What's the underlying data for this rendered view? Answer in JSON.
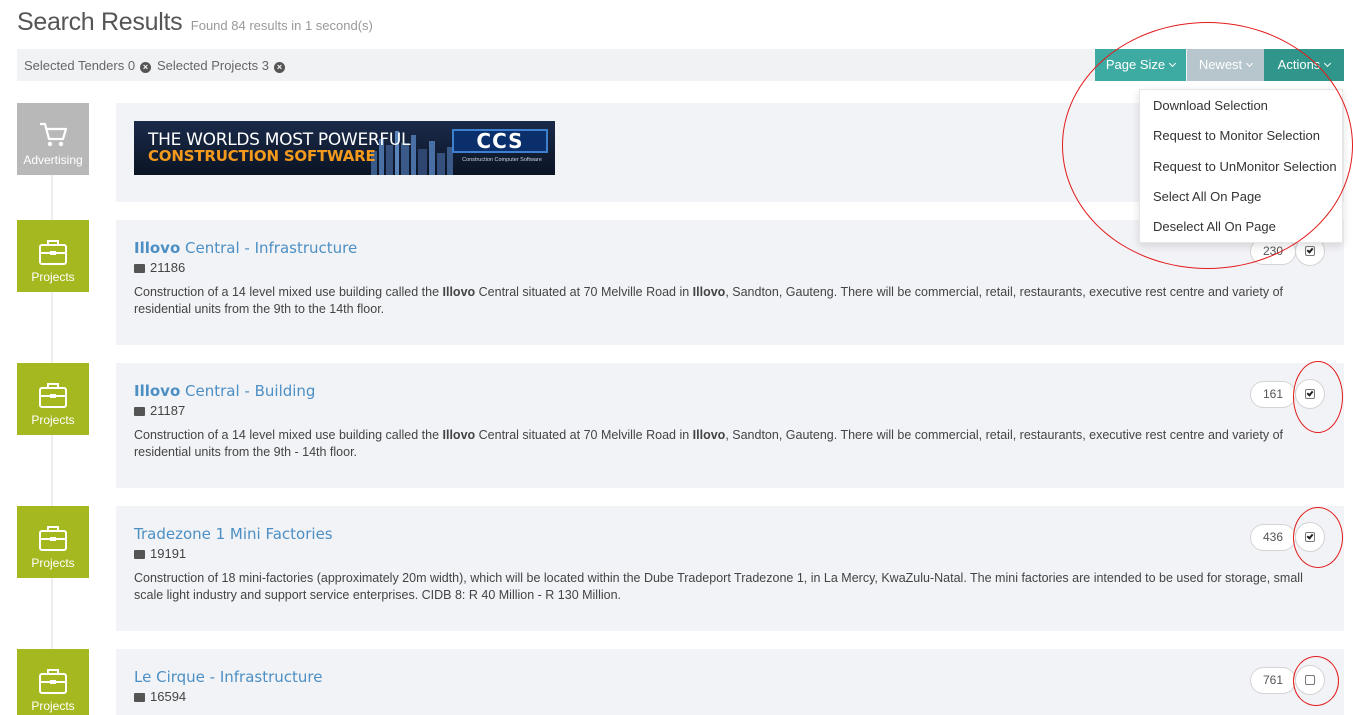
{
  "header": {
    "title": "Search Results",
    "subtitle": "Found 84 results in 1 second(s)"
  },
  "selection": {
    "tenders_label": "Selected Tenders 0",
    "projects_label": "Selected Projects 3",
    "clear_glyph": "×"
  },
  "toolbar": {
    "page_size_label": "Page Size",
    "newest_label": "Newest",
    "actions_label": "Actions"
  },
  "actions_menu": {
    "items": [
      "Download Selection",
      "Request to Monitor Selection",
      "Request to UnMonitor Selection",
      "Select All On Page",
      "Deselect All On Page"
    ]
  },
  "advert": {
    "tile_label": "Advertising",
    "banner_line1": "THE WORLDS MOST POWERFUL",
    "banner_line2": "CONSTRUCTION SOFTWARE",
    "banner_logo": "CCS",
    "banner_logo_sub": "Construction Computer Software"
  },
  "results": [
    {
      "tile_label": "Projects",
      "title_hl": "Illovo",
      "title_rest": " Central - Infrastructure",
      "id": "21186",
      "desc_parts": [
        "Construction of a 14 level mixed use building called the ",
        "Illovo",
        " Central situated at 70 Melville Road in ",
        "Illovo",
        ", Sandton, Gauteng. There will be commercial, retail, restaurants, executive rest centre and variety of residential units from the 9th to the 14th floor."
      ],
      "count": "230",
      "checked": true
    },
    {
      "tile_label": "Projects",
      "title_hl": "Illovo",
      "title_rest": " Central - Building",
      "id": "21187",
      "desc_parts": [
        "Construction of a 14 level mixed use building called the ",
        "Illovo",
        " Central situated at 70 Melville Road in ",
        "Illovo",
        ", Sandton, Gauteng. There will be commercial, retail, restaurants, executive rest centre and variety of residential units from the 9th - 14th floor."
      ],
      "count": "161",
      "checked": true
    },
    {
      "tile_label": "Projects",
      "title_hl": "",
      "title_rest": "Tradezone 1 Mini Factories",
      "id": "19191",
      "desc_parts": [
        "Construction of 18 mini-factories (approximately 20m width), which will be located within the Dube Tradeport Tradezone 1, in La Mercy, KwaZulu-Natal. The mini factories are intended to be used for storage, small scale light industry and support service enterprises. CIDB 8: R 40 Million - R 130 Million.",
        "",
        "",
        "",
        ""
      ],
      "count": "436",
      "checked": true
    },
    {
      "tile_label": "Projects",
      "title_hl": "",
      "title_rest": "Le Cirque - Infrastructure",
      "id": "16594",
      "desc_parts": [
        "",
        "",
        "",
        "",
        ""
      ],
      "count": "761",
      "checked": false
    }
  ],
  "colors": {
    "teal": "#3eaba2",
    "teal_dark": "#30968b",
    "newest_grey": "#b6c6cc",
    "project_green": "#a5b820",
    "link_blue": "#4c8fc4",
    "annotation_red": "#e31b1b"
  }
}
